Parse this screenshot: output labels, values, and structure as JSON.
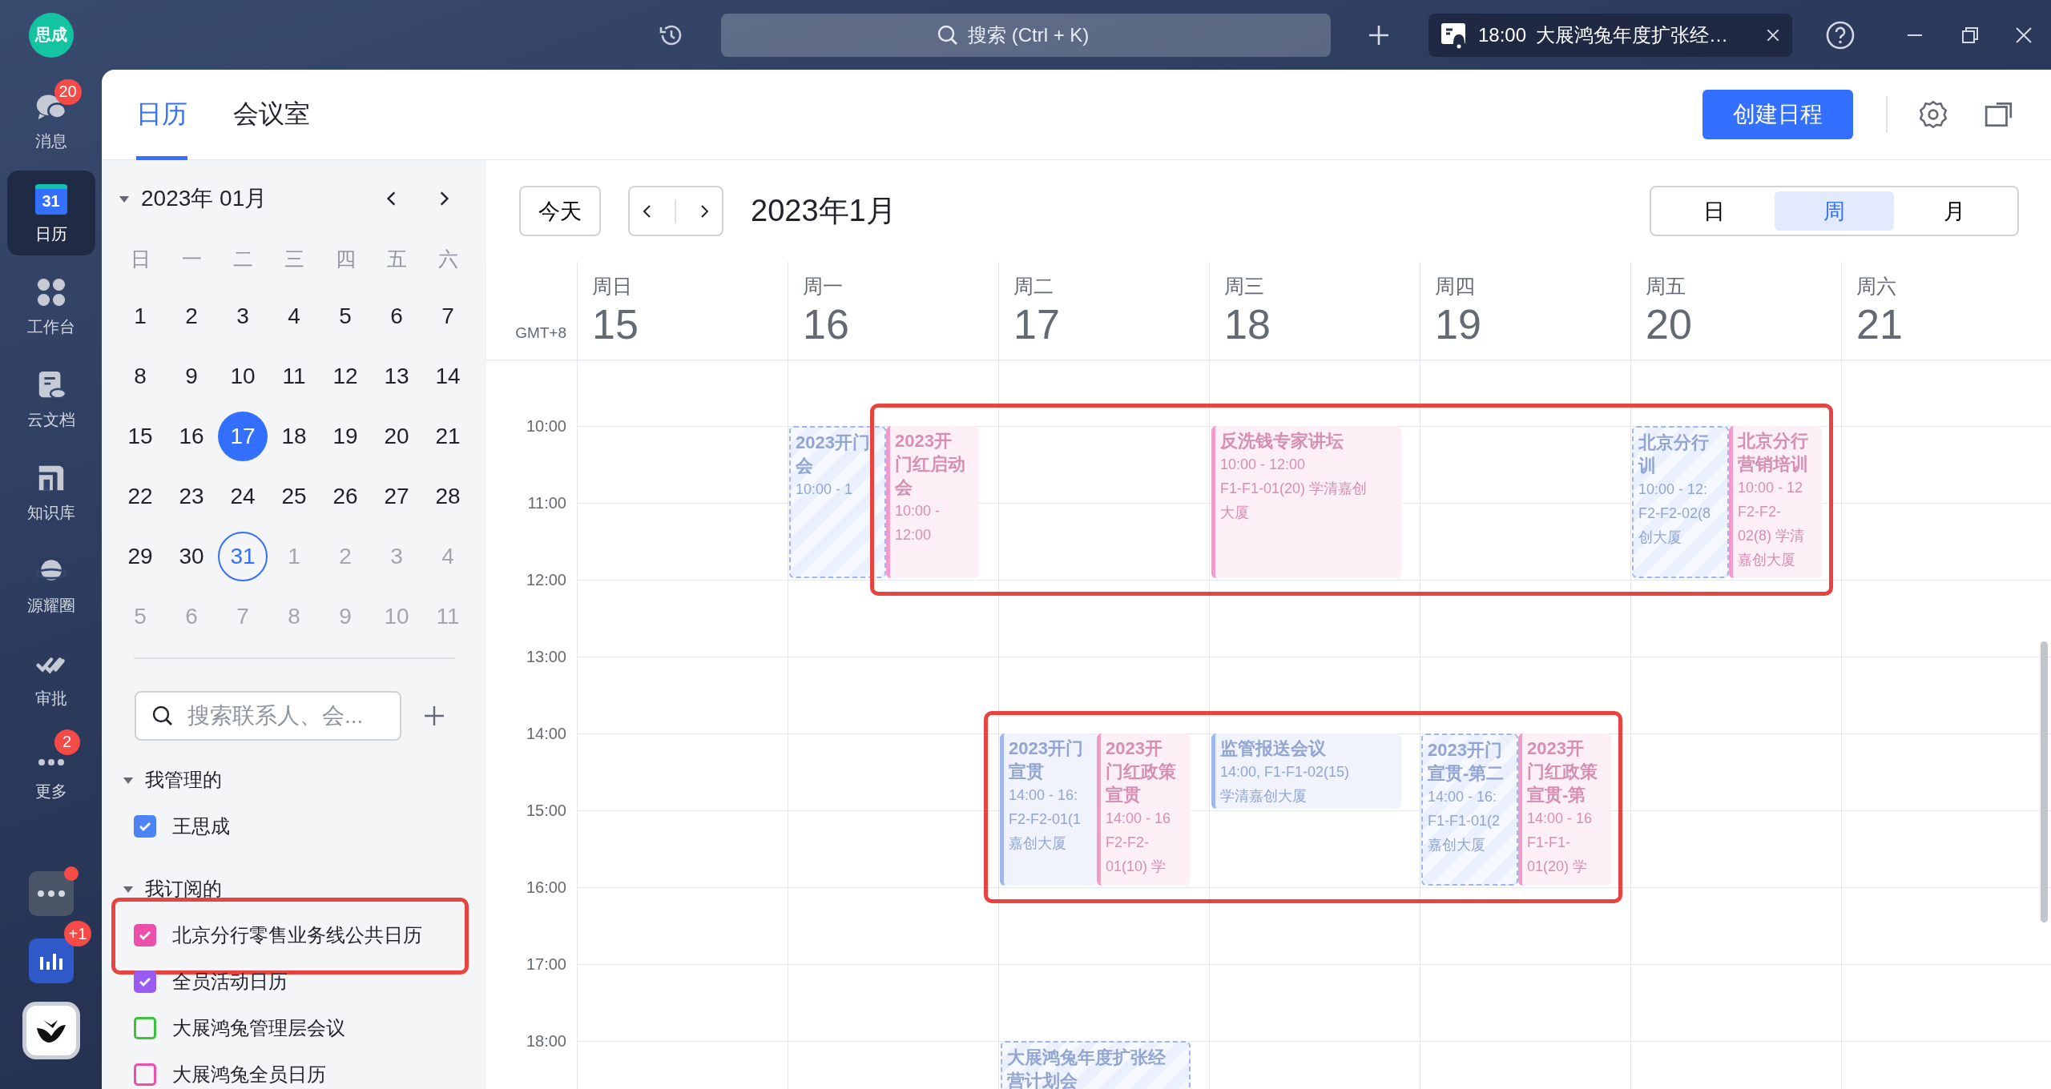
{
  "topbar": {
    "avatar": "思成",
    "search": {
      "placeholder": "搜索 (Ctrl + K)"
    },
    "notification": {
      "time": "18:00",
      "title": "大展鸿兔年度扩张经…"
    }
  },
  "rail": [
    {
      "kind": "chat",
      "label": "消息",
      "badge": "20",
      "selected": false
    },
    {
      "kind": "calendar",
      "label": "日历",
      "icon_text": "31",
      "selected": true
    },
    {
      "kind": "grid",
      "label": "工作台",
      "selected": false
    },
    {
      "kind": "doc",
      "label": "云文档",
      "selected": false
    },
    {
      "kind": "book",
      "label": "知识库",
      "selected": false
    },
    {
      "kind": "planet",
      "label": "源耀圈",
      "selected": false
    },
    {
      "kind": "approve",
      "label": "审批",
      "selected": false
    },
    {
      "kind": "dots",
      "label": "更多",
      "badge": "2",
      "selected": false
    }
  ],
  "rail_apps": [
    {
      "kind": "more",
      "dot": true
    },
    {
      "kind": "chart",
      "badge": "+1"
    },
    {
      "kind": "logo"
    }
  ],
  "tabs": [
    {
      "label": "日历",
      "selected": true
    },
    {
      "label": "会议室",
      "selected": false
    }
  ],
  "create_button": "创建日程",
  "mini_calendar": {
    "title": "2023年 01月",
    "expanded": true,
    "weekdays": [
      "日",
      "一",
      "二",
      "三",
      "四",
      "五",
      "六"
    ],
    "weeks": [
      [
        {
          "d": "1",
          "kind": "current",
          "selected": false
        },
        {
          "d": "2",
          "kind": "current",
          "selected": false
        },
        {
          "d": "3",
          "kind": "current",
          "selected": false
        },
        {
          "d": "4",
          "kind": "current",
          "selected": false
        },
        {
          "d": "5",
          "kind": "current",
          "selected": false
        },
        {
          "d": "6",
          "kind": "current",
          "selected": false
        },
        {
          "d": "7",
          "kind": "current",
          "selected": false
        }
      ],
      [
        {
          "d": "8",
          "kind": "current",
          "selected": false
        },
        {
          "d": "9",
          "kind": "current",
          "selected": false
        },
        {
          "d": "10",
          "kind": "current",
          "selected": false
        },
        {
          "d": "11",
          "kind": "current",
          "selected": false
        },
        {
          "d": "12",
          "kind": "current",
          "selected": false
        },
        {
          "d": "13",
          "kind": "current",
          "selected": false
        },
        {
          "d": "14",
          "kind": "current",
          "selected": false
        }
      ],
      [
        {
          "d": "15",
          "kind": "current",
          "selected": false
        },
        {
          "d": "16",
          "kind": "current",
          "selected": false
        },
        {
          "d": "17",
          "kind": "current",
          "selected": true
        },
        {
          "d": "18",
          "kind": "current",
          "selected": false
        },
        {
          "d": "19",
          "kind": "current",
          "selected": false
        },
        {
          "d": "20",
          "kind": "current",
          "selected": false
        },
        {
          "d": "21",
          "kind": "current",
          "selected": false
        }
      ],
      [
        {
          "d": "22",
          "kind": "current",
          "selected": false
        },
        {
          "d": "23",
          "kind": "current",
          "selected": false
        },
        {
          "d": "24",
          "kind": "current",
          "selected": false
        },
        {
          "d": "25",
          "kind": "current",
          "selected": false
        },
        {
          "d": "26",
          "kind": "current",
          "selected": false
        },
        {
          "d": "27",
          "kind": "current",
          "selected": false
        },
        {
          "d": "28",
          "kind": "current",
          "selected": false
        }
      ],
      [
        {
          "d": "29",
          "kind": "current",
          "selected": false
        },
        {
          "d": "30",
          "kind": "current",
          "selected": false
        },
        {
          "d": "31",
          "kind": "today",
          "selected": false
        },
        {
          "d": "1",
          "kind": "other",
          "selected": false
        },
        {
          "d": "2",
          "kind": "other",
          "selected": false
        },
        {
          "d": "3",
          "kind": "other",
          "selected": false
        },
        {
          "d": "4",
          "kind": "other",
          "selected": false
        }
      ],
      [
        {
          "d": "5",
          "kind": "other",
          "selected": false
        },
        {
          "d": "6",
          "kind": "other",
          "selected": false
        },
        {
          "d": "7",
          "kind": "other",
          "selected": false
        },
        {
          "d": "8",
          "kind": "other",
          "selected": false
        },
        {
          "d": "9",
          "kind": "other",
          "selected": false
        },
        {
          "d": "10",
          "kind": "other",
          "selected": false
        },
        {
          "d": "11",
          "kind": "other",
          "selected": false
        }
      ]
    ]
  },
  "calendar_list": {
    "search": {
      "placeholder": "搜索联系人、会..."
    },
    "groups": [
      {
        "title": "我管理的",
        "expanded": true,
        "calendars": [
          {
            "name": "王思成",
            "checked": true,
            "color": "#4e83f5",
            "highlighted": false
          }
        ]
      },
      {
        "title": "我订阅的",
        "expanded": true,
        "calendars": [
          {
            "name": "北京分行零售业务线公共日历",
            "checked": true,
            "color": "#ec4fa9",
            "highlighted": true
          },
          {
            "name": "全员活动日历",
            "checked": true,
            "color": "#9a5cf0",
            "highlighted": false
          },
          {
            "name": "大展鸿兔管理层会议",
            "checked": false,
            "color": "#3cc23c",
            "highlighted": false
          },
          {
            "name": "大展鸿兔全员日历",
            "checked": false,
            "color": "#ec4fa9",
            "highlighted": false
          }
        ]
      }
    ]
  },
  "toolbar": {
    "today": "今天",
    "title": "2023年1月",
    "views": [
      {
        "label": "日",
        "selected": false
      },
      {
        "label": "周",
        "selected": true
      },
      {
        "label": "月",
        "selected": false
      }
    ]
  },
  "week": {
    "timezone": "GMT+8",
    "days": [
      {
        "name": "周日",
        "date": "15"
      },
      {
        "name": "周一",
        "date": "16"
      },
      {
        "name": "周二",
        "date": "17"
      },
      {
        "name": "周三",
        "date": "18"
      },
      {
        "name": "周四",
        "date": "19"
      },
      {
        "name": "周五",
        "date": "20"
      },
      {
        "name": "周六",
        "date": "21"
      }
    ],
    "hours": [
      {
        "label": "10:00",
        "events": {
          "mon": [
            {
              "kind": "tentative",
              "color": "#9fb6ee",
              "title_lines": [
                "2023开门",
                "会"
              ],
              "detail_lines": [
                "10:00 - 1"
              ]
            },
            {
              "kind": "accepted",
              "color": "#f29ac8",
              "highlighted": true,
              "title_lines": [
                "2023开",
                "门红启动",
                "会"
              ],
              "detail_lines": [
                "10:00 -",
                "12:00"
              ]
            }
          ],
          "wed": [
            {
              "kind": "accepted",
              "color": "#f29ac8",
              "highlighted": true,
              "title_lines": [
                "反洗钱专家讲坛"
              ],
              "detail_lines": [
                "10:00 - 12:00",
                "F1-F1-01(20) 学清嘉创",
                "大厦"
              ]
            }
          ],
          "fri": [
            {
              "kind": "tentative",
              "color": "#9fb6ee",
              "highlighted": true,
              "title_lines": [
                "北京分行",
                "训"
              ],
              "detail_lines": [
                "10:00 - 12:",
                "F2-F2-02(8",
                "创大厦"
              ]
            },
            {
              "kind": "accepted",
              "color": "#f29ac8",
              "highlighted": true,
              "title_lines": [
                "北京分行",
                "营销培训"
              ],
              "detail_lines": [
                "10:00 - 12",
                "F2-F2-",
                "02(8) 学清",
                "嘉创大厦"
              ]
            }
          ]
        }
      },
      {
        "label": "11:00"
      },
      {
        "label": "12:00"
      },
      {
        "label": "13:00"
      },
      {
        "label": "14:00",
        "events": {
          "tue": [
            {
              "kind": "accepted",
              "color": "#9fb6ee",
              "highlighted": true,
              "title_lines": [
                "2023开门",
                "宣贯"
              ],
              "detail_lines": [
                "14:00 - 16:",
                "F2-F2-01(1",
                "嘉创大厦"
              ]
            },
            {
              "kind": "accepted",
              "color": "#f29ac8",
              "highlighted": true,
              "title_lines": [
                "2023开",
                "门红政策",
                "宣贯"
              ],
              "detail_lines": [
                "14:00 - 16",
                "F2-F2-",
                "01(10) 学"
              ]
            }
          ],
          "wed": [
            {
              "kind": "brief",
              "color": "#9fb6ee",
              "highlighted": true,
              "title_lines": [
                "监管报送会议"
              ],
              "detail_lines": [
                "14:00, F1-F1-02(15)",
                "学清嘉创大厦"
              ]
            }
          ],
          "thu": [
            {
              "kind": "tentative",
              "color": "#9fb6ee",
              "highlighted": true,
              "title_lines": [
                "2023开门",
                "宣贯-第二"
              ],
              "detail_lines": [
                "14:00 - 16:",
                "F1-F1-01(2",
                "嘉创大厦"
              ]
            },
            {
              "kind": "accepted",
              "color": "#f29ac8",
              "highlighted": true,
              "title_lines": [
                "2023开",
                "门红政策",
                "宣贯-第"
              ],
              "detail_lines": [
                "14:00 - 16",
                "F1-F1-",
                "01(20) 学"
              ]
            }
          ]
        }
      },
      {
        "label": "15:00"
      },
      {
        "label": "16:00"
      },
      {
        "label": "17:00"
      },
      {
        "label": "18:00",
        "events": {
          "tue": [
            {
              "kind": "tentative",
              "color": "#9fb6ee",
              "title_lines": [
                "大展鸿兔年度扩张经",
                "营计划会"
              ]
            }
          ]
        }
      }
    ]
  }
}
